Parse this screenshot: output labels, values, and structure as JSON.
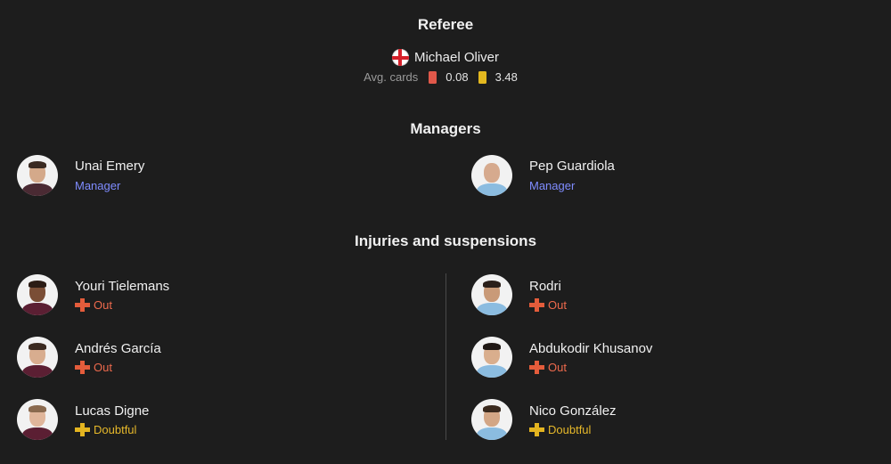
{
  "referee": {
    "title": "Referee",
    "name": "Michael Oliver",
    "flag_icon": "england-flag-icon",
    "avg_cards_label": "Avg. cards",
    "red_cards": "0.08",
    "yellow_cards": "3.48"
  },
  "managers": {
    "title": "Managers",
    "home": {
      "name": "Unai Emery",
      "role": "Manager"
    },
    "away": {
      "name": "Pep Guardiola",
      "role": "Manager"
    }
  },
  "injuries": {
    "title": "Injuries and suspensions",
    "home": [
      {
        "name": "Youri Tielemans",
        "status": "Out"
      },
      {
        "name": "Andrés García",
        "status": "Out"
      },
      {
        "name": "Lucas Digne",
        "status": "Doubtful"
      }
    ],
    "away": [
      {
        "name": "Rodri",
        "status": "Out"
      },
      {
        "name": "Abdukodir Khusanov",
        "status": "Out"
      },
      {
        "name": "Nico González",
        "status": "Doubtful"
      }
    ]
  },
  "colors": {
    "background": "#1d1d1d",
    "manager_role": "#7f8cff",
    "out": "#ee6a4d",
    "doubtful": "#e6b82a",
    "red_card": "#e0584a",
    "yellow_card": "#e3b81f"
  }
}
